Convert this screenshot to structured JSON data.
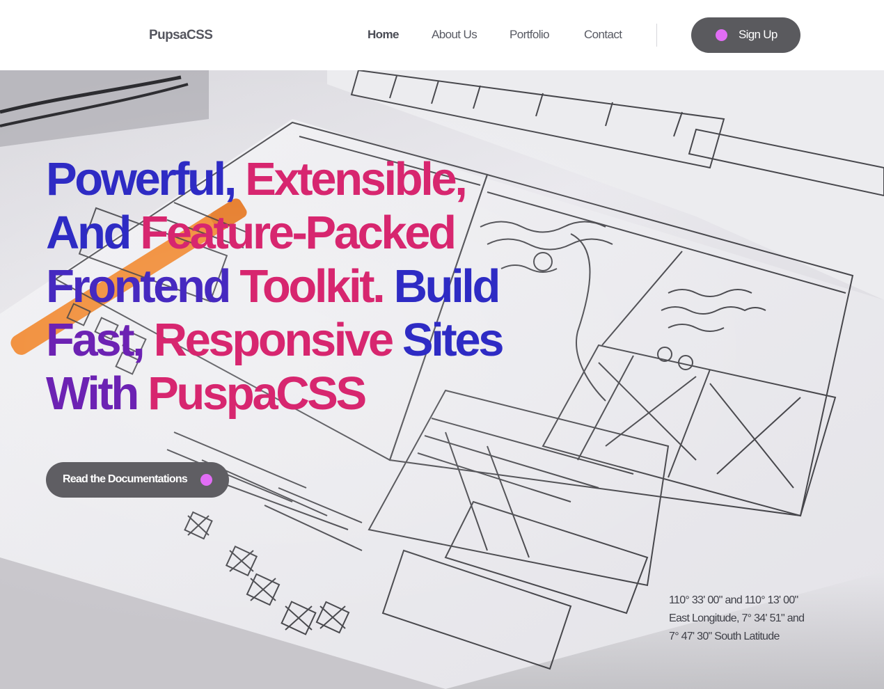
{
  "header": {
    "brand": "PupsaCSS",
    "nav": [
      {
        "label": "Home",
        "active": true
      },
      {
        "label": "About Us",
        "active": false
      },
      {
        "label": "Portfolio",
        "active": false
      },
      {
        "label": "Contact",
        "active": false
      }
    ],
    "signup_label": "Sign Up"
  },
  "hero": {
    "headline_lines": [
      [
        {
          "text": "Powerful,",
          "color": "blue"
        },
        {
          "text": "Extensible,",
          "color": "pink"
        }
      ],
      [
        {
          "text": "And",
          "color": "blue"
        },
        {
          "text": "Feature-Packed",
          "color": "pink"
        }
      ],
      [
        {
          "text": "Frontend",
          "color": "purple"
        },
        {
          "text": "Toolkit.",
          "color": "pink"
        },
        {
          "text": "Build",
          "color": "blue"
        }
      ],
      [
        {
          "text": "Fast,",
          "color": "purple"
        },
        {
          "text": "Responsive",
          "color": "pink"
        },
        {
          "text": "Sites",
          "color": "blue"
        }
      ],
      [
        {
          "text": "With",
          "color": "purple"
        },
        {
          "text": "PuspaCSS",
          "color": "pink"
        }
      ]
    ],
    "cta_label": "Read the Documentations",
    "coordinates": [
      "110° 33' 00\" and 110° 13' 00\"",
      "East Longitude, 7° 34' 51\" and",
      "7° 47' 30\" South Latitude"
    ]
  },
  "colors": {
    "accent_dot": "#e16df5",
    "button_bg": "#5a5a5e",
    "headline_blue": "#2e2bc4",
    "headline_purple": "#6c22b3",
    "headline_pink": "#d7266f"
  }
}
